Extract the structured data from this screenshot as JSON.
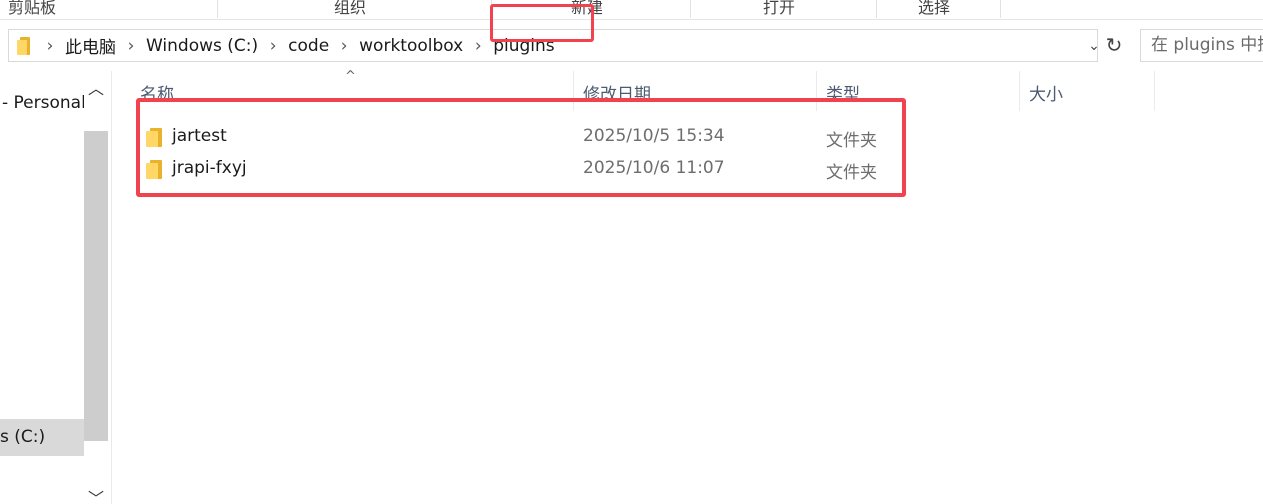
{
  "ribbon": {
    "groups": [
      "剪贴板",
      "组织",
      "新建",
      "打开",
      "选择"
    ]
  },
  "address_bar": {
    "breadcrumbs": [
      "此电脑",
      "Windows  (C:)",
      "code",
      "worktoolbox",
      "plugins"
    ],
    "dropdown_icon": "chevron-down-icon",
    "refresh_icon": "refresh-icon"
  },
  "search": {
    "placeholder": "在 plugins 中搜索"
  },
  "navigation": {
    "items": [
      " - Personal",
      "s  (C:)"
    ]
  },
  "file_list": {
    "columns": [
      "名称",
      "修改日期",
      "类型",
      "大小"
    ],
    "rows": [
      {
        "name": "jartest",
        "modified": "2025/10/5 15:34",
        "type": "文件夹",
        "size": ""
      },
      {
        "name": "jrapi-fxyj",
        "modified": "2025/10/6 11:07",
        "type": "文件夹",
        "size": ""
      }
    ]
  },
  "colors": {
    "highlight_red": "#f0434f",
    "folder_yellow": "#ffd766",
    "selected_nav_bg": "#d9d9d9"
  }
}
